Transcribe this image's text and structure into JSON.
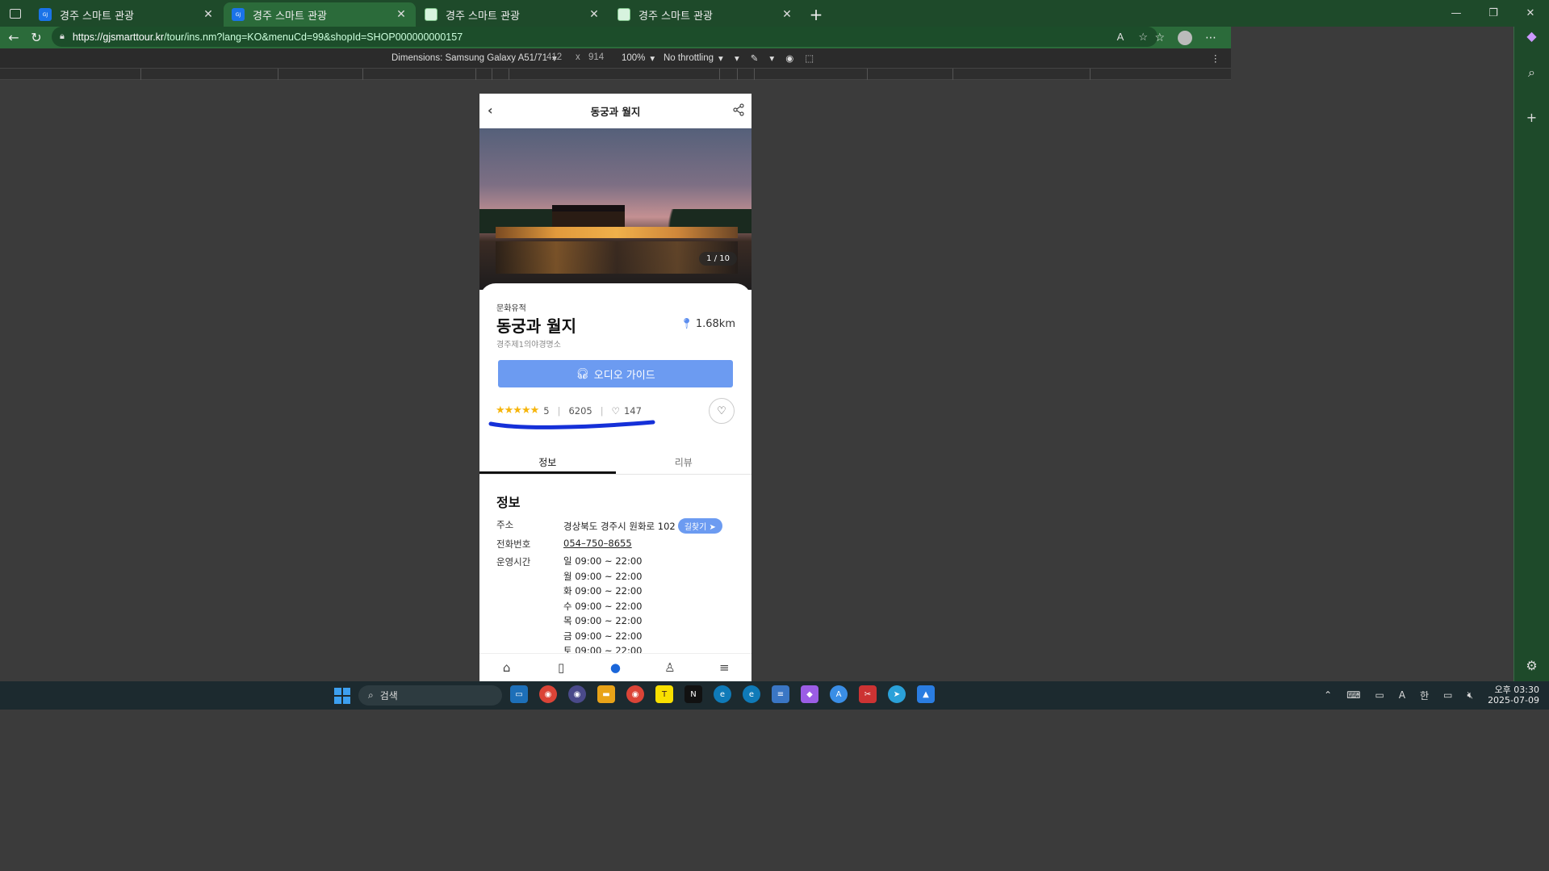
{
  "browser": {
    "tabs": [
      {
        "title": "경주 스마트 관광",
        "active": false,
        "favicon": "blue"
      },
      {
        "title": "경주 스마트 관광",
        "active": true,
        "favicon": "blue"
      },
      {
        "title": "경주 스마트 관광",
        "active": false,
        "favicon": "green"
      },
      {
        "title": "경주 스마트 관광",
        "active": false,
        "favicon": "green"
      }
    ],
    "url_host": "https://gjsmarttour.kr",
    "url_path": "/tour/ins.nm?lang=KO&menuCd=99&shopId=SHOP000000000157"
  },
  "devtools": {
    "dimensions_label": "Dimensions: Samsung Galaxy A51/71",
    "width": "412",
    "times": "x",
    "height": "914",
    "zoom": "100%",
    "throttling": "No throttling"
  },
  "page": {
    "header_title": "동궁과 월지",
    "image_counter": "1 / 10",
    "category": "문화유적",
    "name": "동궁과 월지",
    "distance": "1.68km",
    "subtitle": "경주제1의야경명소",
    "audio_guide": "오디오 가이드",
    "rating": 5,
    "rating_text": "5",
    "views": "6205",
    "likes": "147",
    "tabs": [
      "정보",
      "리뷰"
    ],
    "info_heading": "정보",
    "address_label": "주소",
    "address": "경상북도 경주시 원화로 102",
    "directions_btn": "길찾기",
    "phone_label": "전화번호",
    "phone": "054–750–8655",
    "hours_label": "운영시간",
    "hours": [
      "일 09:00 ~ 22:00",
      "월 09:00 ~ 22:00",
      "화 09:00 ~ 22:00",
      "수 09:00 ~ 22:00",
      "목 09:00 ~ 22:00",
      "금 09:00 ~ 22:00",
      "토 09:00 ~ 22:00"
    ]
  },
  "taskbar": {
    "search_placeholder": "검색",
    "time": "오후 03:30",
    "date": "2025-07-09",
    "ime": "한"
  },
  "colors": {
    "browser_frame": "#1e4a2a",
    "accent_blue": "#6c9bf1",
    "star": "#f6b50c",
    "annotation_stroke": "#1530d8"
  }
}
